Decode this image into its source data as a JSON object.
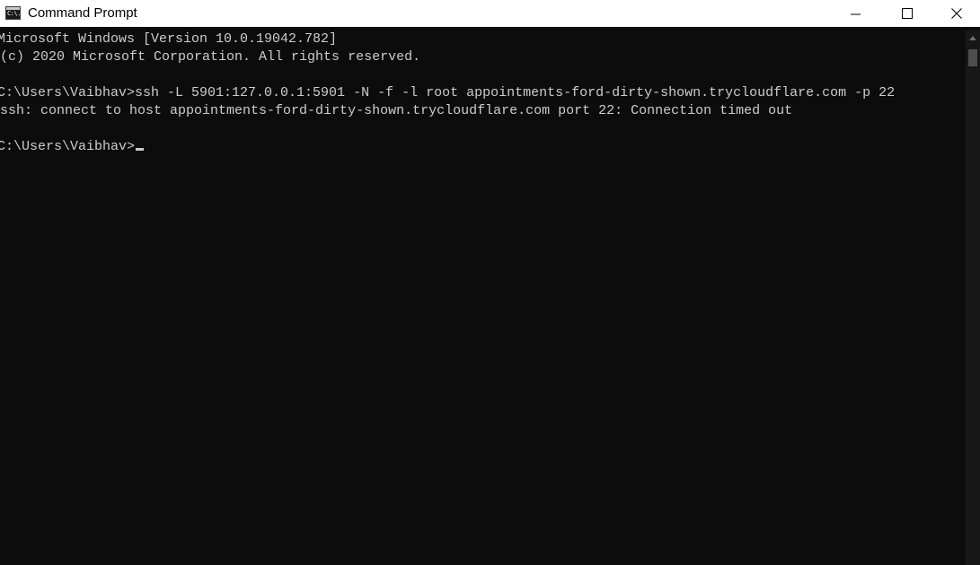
{
  "window": {
    "title": "Command Prompt",
    "app_icon": "cmd-icon",
    "app_icon_glyph": "C:\\.",
    "controls": {
      "minimize_icon": "minimize-icon",
      "maximize_icon": "maximize-icon",
      "close_icon": "close-icon"
    }
  },
  "console": {
    "lines": [
      "Microsoft Windows [Version 10.0.19042.782]",
      "(c) 2020 Microsoft Corporation. All rights reserved.",
      "",
      "C:\\Users\\Vaibhav>ssh -L 5901:127.0.0.1:5901 -N -f -l root appointments-ford-dirty-shown.trycloudflare.com -p 22",
      "ssh: connect to host appointments-ford-dirty-shown.trycloudflare.com port 22: Connection timed out",
      "",
      "C:\\Users\\Vaibhav>"
    ],
    "colors": {
      "background": "#0c0c0c",
      "text": "#cccccc"
    }
  }
}
